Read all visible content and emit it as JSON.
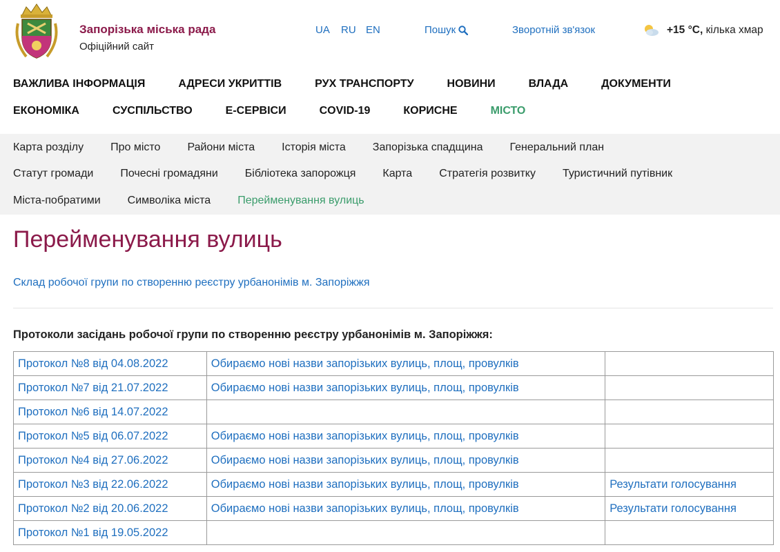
{
  "header": {
    "site_title": "Запорізька міська рада",
    "site_subtitle": "Офіційний сайт",
    "languages": [
      "UA",
      "RU",
      "EN"
    ],
    "search_label": "Пошук",
    "feedback_label": "Зворотній зв'язок",
    "weather": {
      "temperature": "+15 °C,",
      "description": "кілька хмар",
      "icon": "partly-cloudy-icon"
    }
  },
  "main_nav": {
    "row1": [
      "ВАЖЛИВА ІНФОРМАЦІЯ",
      "АДРЕСИ УКРИТТІВ",
      "РУХ ТРАНСПОРТУ",
      "НОВИНИ",
      "ВЛАДА",
      "ДОКУМЕНТИ"
    ],
    "row2": [
      "ЕКОНОМІКА",
      "СУСПІЛЬСТВО",
      "Е-СЕРВІСИ",
      "COVID-19",
      "КОРИСНЕ",
      "МІСТО"
    ],
    "active": "МІСТО"
  },
  "sub_nav": {
    "row1": [
      "Карта розділу",
      "Про місто",
      "Райони міста",
      "Історія міста",
      "Запорізька спадщина",
      "Генеральний план"
    ],
    "row2": [
      "Статут громади",
      "Почесні громадяни",
      "Бібліотека запорожця",
      "Карта",
      "Стратегія розвитку",
      "Туристичний путівник"
    ],
    "row3": [
      "Міста-побратими",
      "Символіка міста",
      "Перейменування вулиць"
    ],
    "active": "Перейменування вулиць"
  },
  "content": {
    "title": "Перейменування вулиць",
    "group_link": "Склад робочої групи по створенню реєстру урбанонімів м. Запоріжжя",
    "protocols_heading": "Протоколи засідань робочої групи по створенню реєстру урбанонімів м. Запоріжжя:",
    "protocols": [
      {
        "protocol": "Протокол №8 від 04.08.2022",
        "names": "Обираємо нові назви запорізьких вулиць, площ, провулків",
        "results": ""
      },
      {
        "protocol": "Протокол №7 від 21.07.2022",
        "names": "Обираємо нові назви запорізьких вулиць, площ, провулків",
        "results": ""
      },
      {
        "protocol": "Протокол №6 від 14.07.2022",
        "names": "",
        "results": ""
      },
      {
        "protocol": "Протокол №5 від 06.07.2022",
        "names": "Обираємо нові назви запорізьких вулиць, площ, провулків",
        "results": ""
      },
      {
        "protocol": "Протокол №4 від 27.06.2022",
        "names": "Обираємо нові назви запорізьких вулиць, площ, провулків",
        "results": ""
      },
      {
        "protocol": "Протокол №3 від 22.06.2022",
        "names": "Обираємо нові назви запорізьких вулиць, площ, провулків",
        "results": "Результати голосування"
      },
      {
        "protocol": "Протокол №2 від 20.06.2022",
        "names": "Обираємо нові назви запорізьких вулиць, площ, провулків",
        "results": "Результати голосування"
      },
      {
        "protocol": "Протокол №1 від 19.05.2022",
        "names": "",
        "results": ""
      }
    ]
  },
  "colors": {
    "brand": "#8b1a4a",
    "link": "#1f6fbf",
    "active_nav": "#3a9c6b",
    "subnav_bg": "#f2f2f2"
  }
}
